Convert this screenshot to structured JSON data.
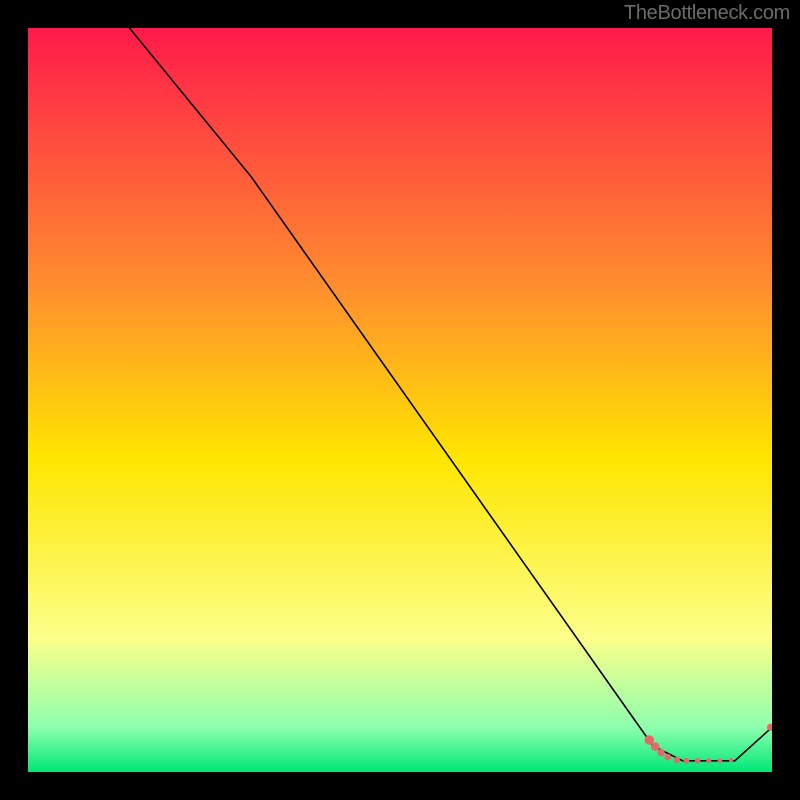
{
  "attribution": "TheBottleneck.com",
  "colors": {
    "gradient_stops": [
      {
        "offset": "0%",
        "color": "#ff1a4b"
      },
      {
        "offset": "35%",
        "color": "#ff8f2e"
      },
      {
        "offset": "58%",
        "color": "#ffe600"
      },
      {
        "offset": "82%",
        "color": "#fcff8a"
      },
      {
        "offset": "94%",
        "color": "#8effae"
      },
      {
        "offset": "100%",
        "color": "#00e676"
      }
    ],
    "curve": "#000000",
    "marker_fill": "#e46a6a",
    "marker_glow": "#e46a6a"
  },
  "chart_data": {
    "type": "line",
    "title": "",
    "xlabel": "",
    "ylabel": "",
    "xlim": [
      0,
      100
    ],
    "ylim": [
      0,
      100
    ],
    "curve_points": [
      {
        "x": 12,
        "y": 102
      },
      {
        "x": 30,
        "y": 80
      },
      {
        "x": 84,
        "y": 3.5
      },
      {
        "x": 88,
        "y": 1.5
      },
      {
        "x": 95,
        "y": 1.5
      },
      {
        "x": 100,
        "y": 6
      }
    ],
    "markers": [
      {
        "x": 83.5,
        "y": 4.3,
        "r": 4.8
      },
      {
        "x": 84.3,
        "y": 3.4,
        "r": 4.3
      },
      {
        "x": 85.1,
        "y": 2.6,
        "r": 3.8
      },
      {
        "x": 86.0,
        "y": 2.0,
        "r": 3.4
      },
      {
        "x": 87.2,
        "y": 1.6,
        "r": 3.2
      },
      {
        "x": 88.5,
        "y": 1.5,
        "r": 3.0
      },
      {
        "x": 90.0,
        "y": 1.5,
        "r": 2.8
      },
      {
        "x": 91.5,
        "y": 1.5,
        "r": 2.6
      },
      {
        "x": 93.0,
        "y": 1.5,
        "r": 2.4
      },
      {
        "x": 94.5,
        "y": 1.6,
        "r": 2.2
      },
      {
        "x": 99.8,
        "y": 6.0,
        "r": 3.6
      }
    ]
  }
}
